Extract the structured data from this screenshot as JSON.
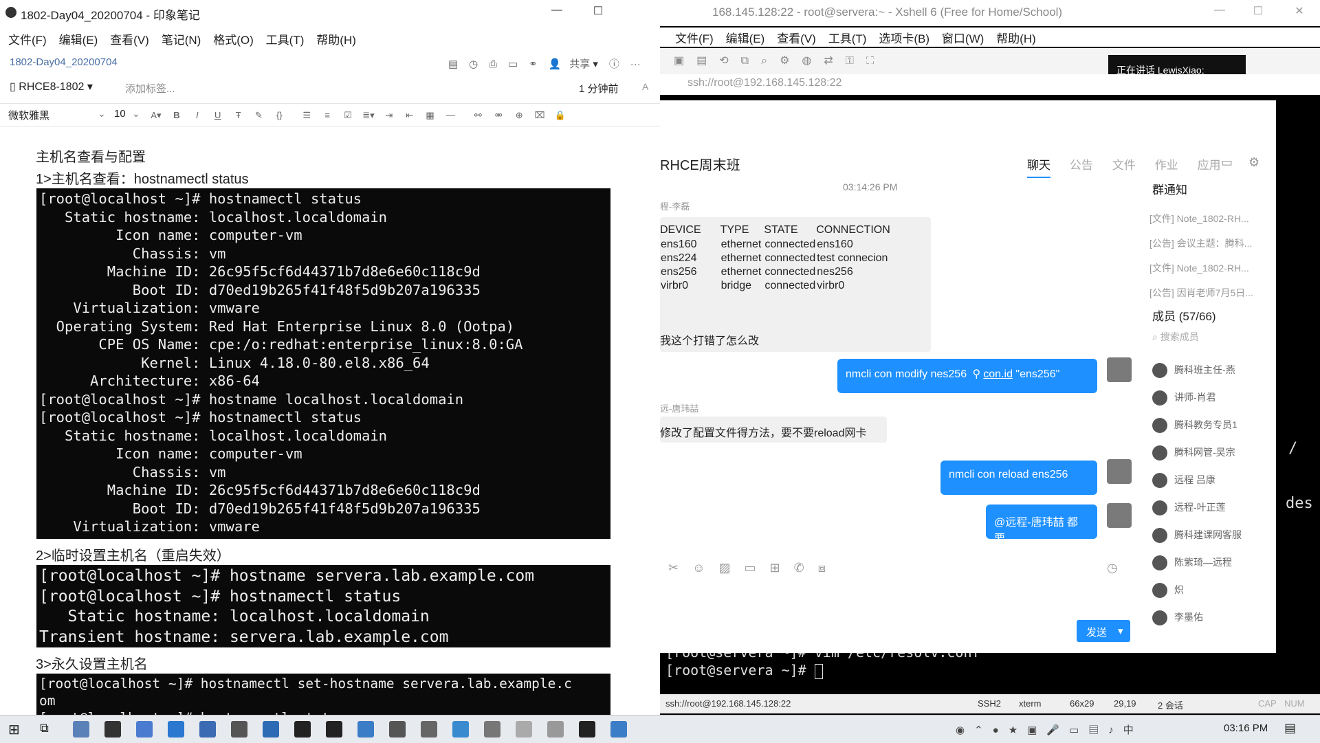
{
  "evernote": {
    "title": "1802-Day04_20200704 - 印象笔记",
    "menu": [
      "文件(F)",
      "编辑(E)",
      "查看(V)",
      "笔记(N)",
      "格式(O)",
      "工具(T)",
      "帮助(H)"
    ],
    "note_title": "1802-Day04_20200704",
    "share_label": "共享",
    "notebook": "RHCE8-1802",
    "add_tag": "添加标签...",
    "time_ago": "1 分钟前",
    "font_name": "微软雅黑",
    "font_size": "10",
    "heading": "主机名查看与配置",
    "sec1": "1>主机名查看：hostnamectl status",
    "term1": [
      "[root@localhost ~]# hostnamectl status",
      "   Static hostname: localhost.localdomain",
      "         Icon name: computer-vm",
      "           Chassis: vm",
      "        Machine ID: 26c95f5cf6d44371b7d8e6e60c118c9d",
      "           Boot ID: d70ed19b265f41f48f5d9b207a196335",
      "    Virtualization: vmware",
      "  Operating System: Red Hat Enterprise Linux 8.0 (Ootpa)",
      "       CPE OS Name: cpe:/o:redhat:enterprise_linux:8.0:GA",
      "            Kernel: Linux 4.18.0-80.el8.x86_64",
      "      Architecture: x86-64",
      "[root@localhost ~]# hostname localhost.localdomain",
      "[root@localhost ~]# hostnamectl status",
      "   Static hostname: localhost.localdomain",
      "         Icon name: computer-vm",
      "           Chassis: vm",
      "        Machine ID: 26c95f5cf6d44371b7d8e6e60c118c9d",
      "           Boot ID: d70ed19b265f41f48f5d9b207a196335",
      "    Virtualization: vmware"
    ],
    "sec2": "2>临时设置主机名（重启失效）",
    "term2": [
      "[root@localhost ~]# hostname servera.lab.example.com",
      "[root@localhost ~]# hostnamectl status",
      "   Static hostname: localhost.localdomain",
      "Transient hostname: servera.lab.example.com"
    ],
    "sec3": "3>永久设置主机名",
    "term3": [
      "[root@localhost ~]# hostnamectl set-hostname servera.lab.example.c",
      "om",
      "[root@localhost ~]# hostnamectl status"
    ]
  },
  "xshell": {
    "title": "168.145.128:22 - root@servera:~ - Xshell 6 (Free for Home/School)",
    "overlay_tab": "正在讲话 LewisXiao;",
    "menu": [
      "文件(F)",
      "编辑(E)",
      "查看(V)",
      "工具(T)",
      "选项卡(B)",
      "窗口(W)",
      "帮助(H)"
    ],
    "address": "ssh://root@192.168.145.128:22",
    "term_lines": [
      "[root@servera ~]# vim /etc/resolv.conf",
      "[root@servera ~]# "
    ],
    "right_frag": [
      "/",
      "des"
    ],
    "status": {
      "addr": "ssh://root@192.168.145.128:22",
      "proto": "SSH2",
      "term": "xterm",
      "size": "66x29",
      "pos": "29,19",
      "sessions": "2 会话",
      "caps": "CAP",
      "num": "NUM"
    }
  },
  "chat": {
    "group": "RHCE周末班",
    "tabs": [
      "聊天",
      "公告",
      "文件",
      "作业",
      "应用"
    ],
    "time": "03:14:26 PM",
    "sender1": "程-李磊",
    "table_header": [
      "DEVICE",
      "TYPE",
      "STATE",
      "CONNECTION"
    ],
    "table_rows": [
      [
        "ens160",
        "ethernet",
        "connected",
        "ens160"
      ],
      [
        "ens224",
        "ethernet",
        "connected",
        "test connecion"
      ],
      [
        "ens256",
        "ethernet",
        "connected",
        "nes256"
      ],
      [
        "virbr0",
        "bridge",
        "connected",
        "virbr0"
      ]
    ],
    "msg1_tail": "我这个打错了怎么改",
    "reply1_a": "nmcli con modify nes256",
    "reply1_link": "con.id",
    "reply1_b": "\"ens256\"",
    "sender2": "远-唐玮喆",
    "msg2": "修改了配置文件得方法，要不要reload网卡",
    "reply2": "nmcli con reload ens256",
    "reply3": "@远程-唐玮喆 都要",
    "send": "发送",
    "notice_title": "群通知",
    "notices": [
      "[文件] Note_1802-RH...",
      "[公告] 会议主题：腾科...",
      "[文件] Note_1802-RH...",
      "[公告] 因肖老师7月5日..."
    ],
    "members_title": "成员 (57/66)",
    "search": "搜索成员",
    "members": [
      "腾科班主任-燕",
      "讲师-肖君",
      "腾科教务专员1",
      "腾科网管-吴宗",
      "远程 吕康",
      "远程-叶正莲",
      "腾科建课网客服",
      "陈紫琦—远程",
      "炽",
      "李墨佑"
    ]
  },
  "taskbar": {
    "time": "03:16 PM"
  }
}
